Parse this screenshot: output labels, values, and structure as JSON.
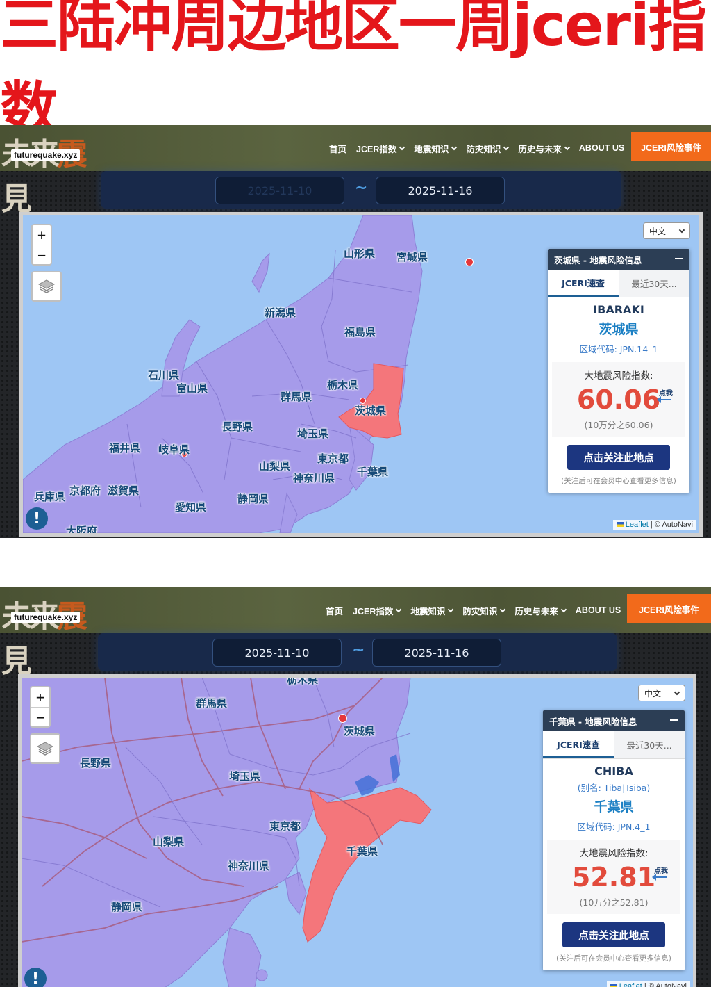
{
  "headline": "三陆冲周边地区一周jceri指数",
  "site": {
    "logo_kanji_left": "未来",
    "logo_kanji_mid": "震",
    "logo_kanji_right": "見",
    "url": "futurequake.xyz"
  },
  "nav": {
    "items": [
      "首页",
      "JCER指数",
      "地震知识",
      "防灾知识",
      "历史与未来",
      "ABOUT US"
    ],
    "cta": "JCERI风险事件"
  },
  "map_common": {
    "lang": "中文",
    "zoom_in": "+",
    "zoom_out": "−",
    "attribution_leaflet": "Leaflet",
    "attribution_rest": " | © AutoNavi",
    "alert_icon": "!"
  },
  "colors": {
    "sea": "#9ec6f4",
    "land": "#a69bea",
    "highlight": "#f4767b",
    "headline": "#e4161b",
    "cta": "#f26a1b"
  },
  "screens": [
    {
      "date_from": "2025-11-10",
      "date_to": "2025-11-16",
      "tilde": "~",
      "labels": [
        "山形県",
        "宮城県",
        "新潟県",
        "福島県",
        "石川県",
        "富山県",
        "栃木県",
        "群馬県",
        "茨城県",
        "長野県",
        "埼玉県",
        "福井県",
        "岐阜県",
        "東京都",
        "千葉県",
        "山梨県",
        "神奈川県",
        "兵庫県",
        "京都府",
        "滋賀県",
        "静岡県",
        "愛知県",
        "大阪府"
      ],
      "panel": {
        "title": "茨城県 - 地震风险信息",
        "tab_active": "JCERI速查",
        "tab_inactive": "最近30天...",
        "roman": "IBARAKI",
        "alias": "",
        "name": "茨城県",
        "code": "区域代码: JPN.14_1",
        "risk_label": "大地震风险指数:",
        "risk_value": "60.06",
        "tap": "点我",
        "risk_sub": "(10万分之60.06)",
        "follow": "点击关注此地点",
        "note": "(关注后可在会员中心查看更多信息)"
      }
    },
    {
      "date_from": "2025-11-10",
      "date_to": "2025-11-16",
      "tilde": "~",
      "labels": [
        "栃木県",
        "群馬県",
        "茨城県",
        "長野県",
        "埼玉県",
        "東京都",
        "山梨県",
        "千葉県",
        "神奈川県",
        "静岡県"
      ],
      "panel": {
        "title": "千葉県 - 地震风险信息",
        "tab_active": "JCERI速查",
        "tab_inactive": "最近30天...",
        "roman": "CHIBA",
        "alias": "(别名: Tiba|Tsiba)",
        "name": "千葉県",
        "code": "区域代码: JPN.4_1",
        "risk_label": "大地震风险指数:",
        "risk_value": "52.81",
        "tap": "点我",
        "risk_sub": "(10万分之52.81)",
        "follow": "点击关注此地点",
        "note": "(关注后可在会员中心查看更多信息)"
      }
    }
  ]
}
